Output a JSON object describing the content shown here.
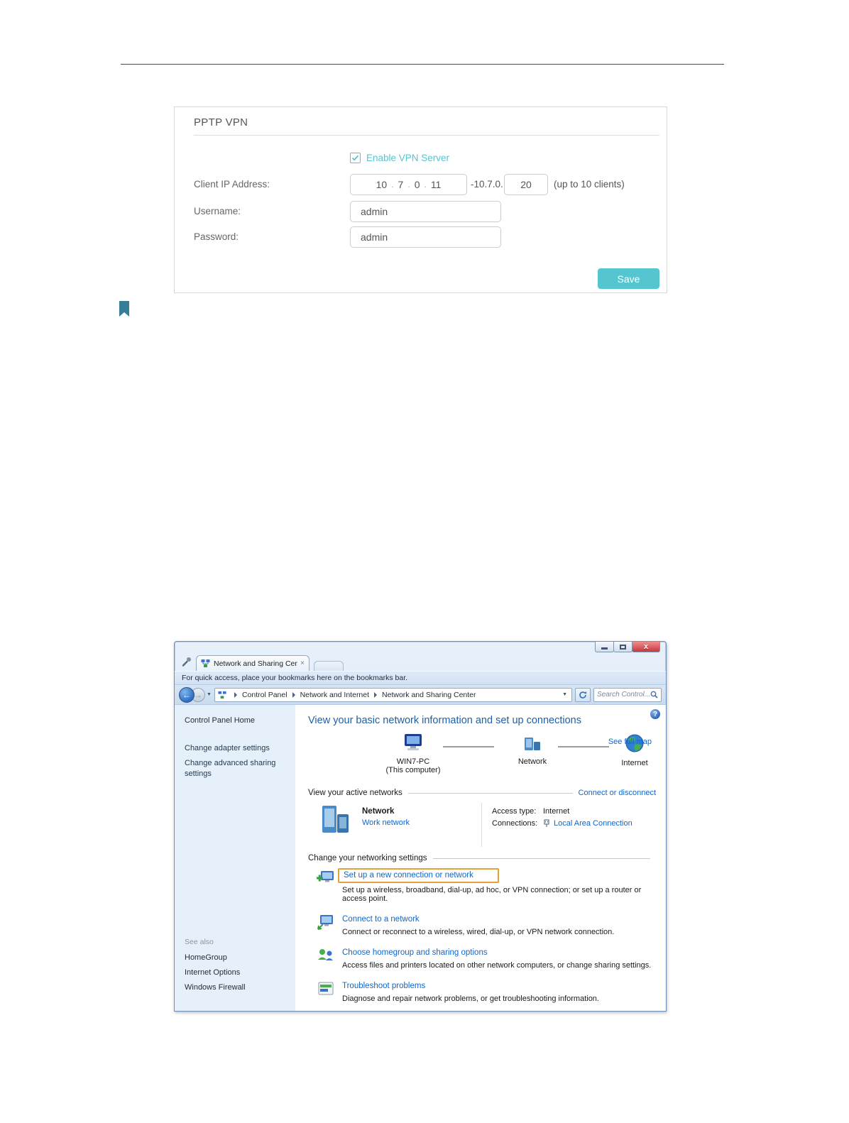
{
  "vpn_panel": {
    "title": "PPTP VPN",
    "enable_label": "Enable VPN Server",
    "client_ip_label": "Client IP Address:",
    "ip_octet_1": "10",
    "ip_octet_2": "7",
    "ip_octet_3": "0",
    "ip_octet_4": "11",
    "ip_dot": ".",
    "ip_suffix": "-10.7.0.",
    "ip_end_value": "20",
    "clients_hint": "(up to 10 clients)",
    "username_label": "Username:",
    "username_value": "admin",
    "password_label": "Password:",
    "password_value": "admin",
    "save_label": "Save",
    "accent_color": "#55c5cf"
  },
  "explorer": {
    "tab_title": "Network and Sharing Cent",
    "tab_close": "×",
    "bookmarks_hint": "For quick access, place your bookmarks here on the bookmarks bar.",
    "breadcrumb": [
      "Control Panel",
      "Network and Internet",
      "Network and Sharing Center"
    ],
    "search_placeholder": "Search Control...",
    "sidebar": {
      "home": "Control Panel Home",
      "task_1": "Change adapter settings",
      "task_2": "Change advanced sharing settings",
      "see_also_label": "See also",
      "see_also_1": "HomeGroup",
      "see_also_2": "Internet Options",
      "see_also_3": "Windows Firewall"
    },
    "main": {
      "heading": "View your basic network information and set up connections",
      "help_glyph": "?",
      "see_full_map": "See full map",
      "map_node_1_label": "WIN7-PC",
      "map_node_1_sub": "(This computer)",
      "map_node_2_label": "Network",
      "map_node_3_label": "Internet",
      "active_networks_label": "View your active networks",
      "connect_or_disconnect": "Connect or disconnect",
      "active_network": {
        "name": "Network",
        "type": "Work network",
        "access_type_label": "Access type:",
        "access_type_value": "Internet",
        "connections_label": "Connections:",
        "connections_value": "Local Area Connection"
      },
      "settings_label": "Change your networking settings",
      "tasks": [
        {
          "title": "Set up a new connection or network",
          "desc": "Set up a wireless, broadband, dial-up, ad hoc, or VPN connection; or set up a router or access point."
        },
        {
          "title": "Connect to a network",
          "desc": "Connect or reconnect to a wireless, wired, dial-up, or VPN network connection."
        },
        {
          "title": "Choose homegroup and sharing options",
          "desc": "Access files and printers located on other network computers, or change sharing settings."
        },
        {
          "title": "Troubleshoot problems",
          "desc": "Diagnose and repair network problems, or get troubleshooting information."
        }
      ],
      "highlight_color": "#e2a23b"
    }
  }
}
